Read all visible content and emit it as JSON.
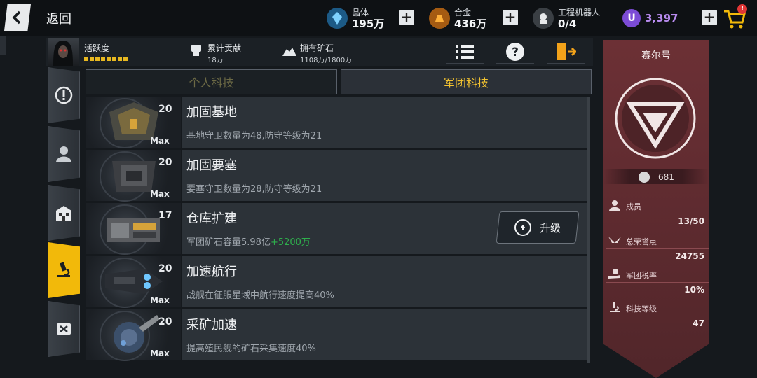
{
  "topbar": {
    "back_label": "返回",
    "crystal": {
      "label": "晶体",
      "value": "195万"
    },
    "alloy": {
      "label": "合金",
      "value": "436万"
    },
    "robots": {
      "label": "工程机器人",
      "value": "0/4"
    },
    "u_currency": {
      "symbol": "U",
      "value": "3,397"
    },
    "cart_badge": "!"
  },
  "infobar": {
    "activity_label": "活跃度",
    "contribution_label": "累计贡献",
    "contribution_value": "18万",
    "ore_label": "拥有矿石",
    "ore_value": "1108万/1800万"
  },
  "tabs": {
    "personal": "个人科技",
    "legion": "军团科技"
  },
  "techs": [
    {
      "level": "20",
      "max": "Max",
      "title": "加固基地",
      "desc": "基地守卫数量为48,防守等级为21",
      "gain": ""
    },
    {
      "level": "20",
      "max": "Max",
      "title": "加固要塞",
      "desc": "要塞守卫数量为28,防守等级为21",
      "gain": ""
    },
    {
      "level": "17",
      "max": "",
      "title": "仓库扩建",
      "desc": "军团矿石容量5.98亿",
      "gain": "+5200万"
    },
    {
      "level": "20",
      "max": "Max",
      "title": "加速航行",
      "desc": "战舰在征服星域中航行速度提高40%",
      "gain": ""
    },
    {
      "level": "20",
      "max": "Max",
      "title": "采矿加速",
      "desc": "提高殖民舰的矿石采集速度40%",
      "gain": ""
    }
  ],
  "upgrade_label": "升级",
  "panel": {
    "name": "赛尔号",
    "score": "681",
    "stats": [
      {
        "label": "成员",
        "value": "13/50"
      },
      {
        "label": "总荣誉点",
        "value": "24755"
      },
      {
        "label": "军团税率",
        "value": "10%"
      },
      {
        "label": "科技等级",
        "value": "47"
      }
    ]
  },
  "colors": {
    "accent": "#f2b90a",
    "panel": "#5e2a2f",
    "gain": "#2eae4c"
  }
}
